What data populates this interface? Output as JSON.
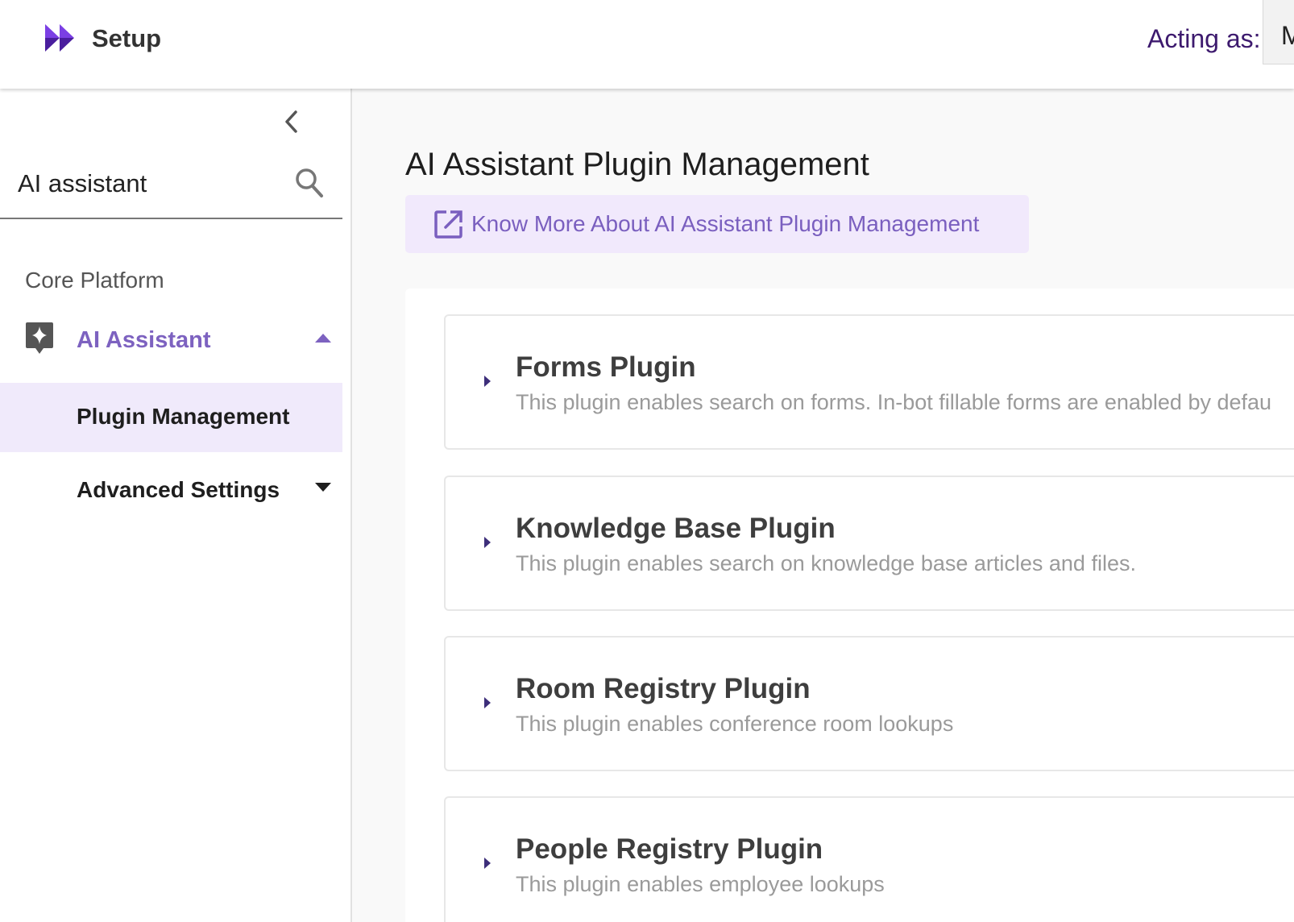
{
  "header": {
    "title": "Setup",
    "acting_as_label": "Acting as:",
    "acting_as_value": "M"
  },
  "sidebar": {
    "search": {
      "value": "AI assistant",
      "placeholder": ""
    },
    "section_label": "Core Platform",
    "items": [
      {
        "label": "AI Assistant",
        "icon": "ai-sparkle-icon",
        "expanded": true
      },
      {
        "label": "Plugin Management",
        "selected": true
      },
      {
        "label": "Advanced Settings",
        "expanded": false
      }
    ]
  },
  "main": {
    "page_title": "AI Assistant Plugin Management",
    "know_more_link": "Know More About AI Assistant Plugin Management",
    "plugins": [
      {
        "title": "Forms Plugin",
        "description": "This plugin enables search on forms. In-bot fillable forms are enabled by defau"
      },
      {
        "title": "Knowledge Base Plugin",
        "description": "This plugin enables search on knowledge base articles and files."
      },
      {
        "title": "Room Registry Plugin",
        "description": "This plugin enables conference room lookups"
      },
      {
        "title": "People Registry Plugin",
        "description": "This plugin enables employee lookups"
      }
    ]
  },
  "colors": {
    "accent": "#7d62c0",
    "accent_bg": "#f1e9fc",
    "acting_as_text": "#3d1a6e",
    "logo_purple": "#6a2fd4"
  }
}
